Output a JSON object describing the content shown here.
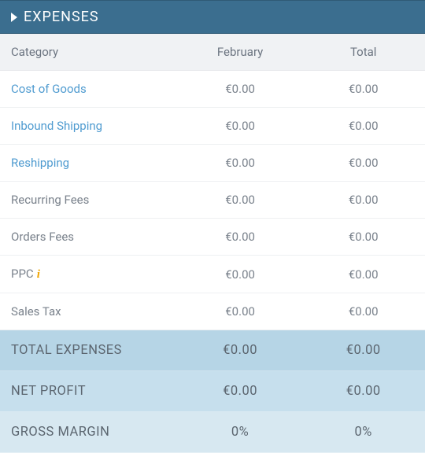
{
  "header": {
    "title": "EXPENSES"
  },
  "columns": {
    "category": "Category",
    "month": "February",
    "total": "Total"
  },
  "rows": [
    {
      "category": "Cost of Goods",
      "month": "€0.00",
      "total": "€0.00",
      "link": true,
      "info": false
    },
    {
      "category": "Inbound Shipping",
      "month": "€0.00",
      "total": "€0.00",
      "link": true,
      "info": false
    },
    {
      "category": "Reshipping",
      "month": "€0.00",
      "total": "€0.00",
      "link": true,
      "info": false
    },
    {
      "category": "Recurring Fees",
      "month": "€0.00",
      "total": "€0.00",
      "link": false,
      "info": false
    },
    {
      "category": "Orders Fees",
      "month": "€0.00",
      "total": "€0.00",
      "link": false,
      "info": false
    },
    {
      "category": "PPC",
      "month": "€0.00",
      "total": "€0.00",
      "link": false,
      "info": true
    },
    {
      "category": "Sales Tax",
      "month": "€0.00",
      "total": "€0.00",
      "link": false,
      "info": false
    }
  ],
  "summary": [
    {
      "label": "TOTAL EXPENSES",
      "month": "€0.00",
      "total": "€0.00"
    },
    {
      "label": "NET PROFIT",
      "month": "€0.00",
      "total": "€0.00"
    },
    {
      "label": "GROSS MARGIN",
      "month": "0%",
      "total": "0%"
    }
  ],
  "chart_data": {
    "type": "table",
    "title": "EXPENSES",
    "columns": [
      "Category",
      "February",
      "Total"
    ],
    "currency": "EUR",
    "rows": [
      {
        "Category": "Cost of Goods",
        "February": 0.0,
        "Total": 0.0
      },
      {
        "Category": "Inbound Shipping",
        "February": 0.0,
        "Total": 0.0
      },
      {
        "Category": "Reshipping",
        "February": 0.0,
        "Total": 0.0
      },
      {
        "Category": "Recurring Fees",
        "February": 0.0,
        "Total": 0.0
      },
      {
        "Category": "Orders Fees",
        "February": 0.0,
        "Total": 0.0
      },
      {
        "Category": "PPC",
        "February": 0.0,
        "Total": 0.0
      },
      {
        "Category": "Sales Tax",
        "February": 0.0,
        "Total": 0.0
      }
    ],
    "summary": {
      "TOTAL EXPENSES": {
        "February": 0.0,
        "Total": 0.0
      },
      "NET PROFIT": {
        "February": 0.0,
        "Total": 0.0
      },
      "GROSS MARGIN": {
        "February": "0%",
        "Total": "0%"
      }
    }
  }
}
